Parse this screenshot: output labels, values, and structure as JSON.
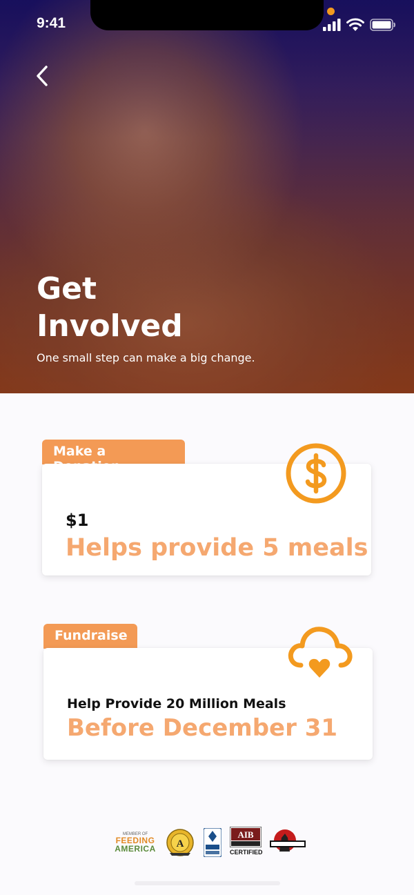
{
  "status_bar": {
    "time": "9:41"
  },
  "hero": {
    "title_line1": "Get",
    "title_line2": "Involved",
    "subtitle": "One small step can make a big change."
  },
  "donation": {
    "tab_label": "Make a Donation",
    "amount": "$1",
    "description": "Helps provide 5 meals",
    "icon": "dollar-circle-icon"
  },
  "fundraise": {
    "tab_label": "Fundraise",
    "line1": "Help Provide 20 Million Meals",
    "line2": "Before December 31",
    "icon": "cloud-heart-icon"
  },
  "badges": {
    "feeding_member": "MEMBER OF",
    "feeding_word1": "FEEDING",
    "feeding_word2": "AMERICA",
    "aib_certified": "CERTIFIED"
  },
  "colors": {
    "accent": "#f39a1f",
    "tab_orange": "#f39a55",
    "highlight_text": "#f5a870"
  }
}
